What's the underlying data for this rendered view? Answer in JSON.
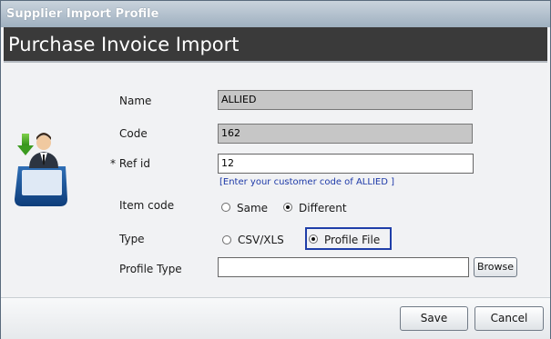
{
  "window": {
    "title": "Supplier Import Profile"
  },
  "header": {
    "title": "Purchase Invoice Import"
  },
  "form": {
    "name_label": "Name",
    "name_value": "ALLIED",
    "code_label": "Code",
    "code_value": "162",
    "refid_label": "* Ref id",
    "refid_value": "12",
    "refid_hint": "[Enter your customer code of ALLIED ]",
    "itemcode_label": "Item code",
    "itemcode_options": [
      "Same",
      "Different"
    ],
    "itemcode_selected": "Different",
    "type_label": "Type",
    "type_options": [
      "CSV/XLS",
      "Profile File"
    ],
    "type_selected": "Profile File",
    "profiletype_label": "Profile Type",
    "profiletype_value": "",
    "browse_label": "Browse"
  },
  "footer": {
    "save_label": "Save",
    "cancel_label": "Cancel"
  },
  "icon": {
    "name": "import-tray-person-icon"
  },
  "colors": {
    "header_bg": "#3a3a3a",
    "hint_text": "#1e3aa8",
    "focus_border": "#1f3ea8"
  }
}
